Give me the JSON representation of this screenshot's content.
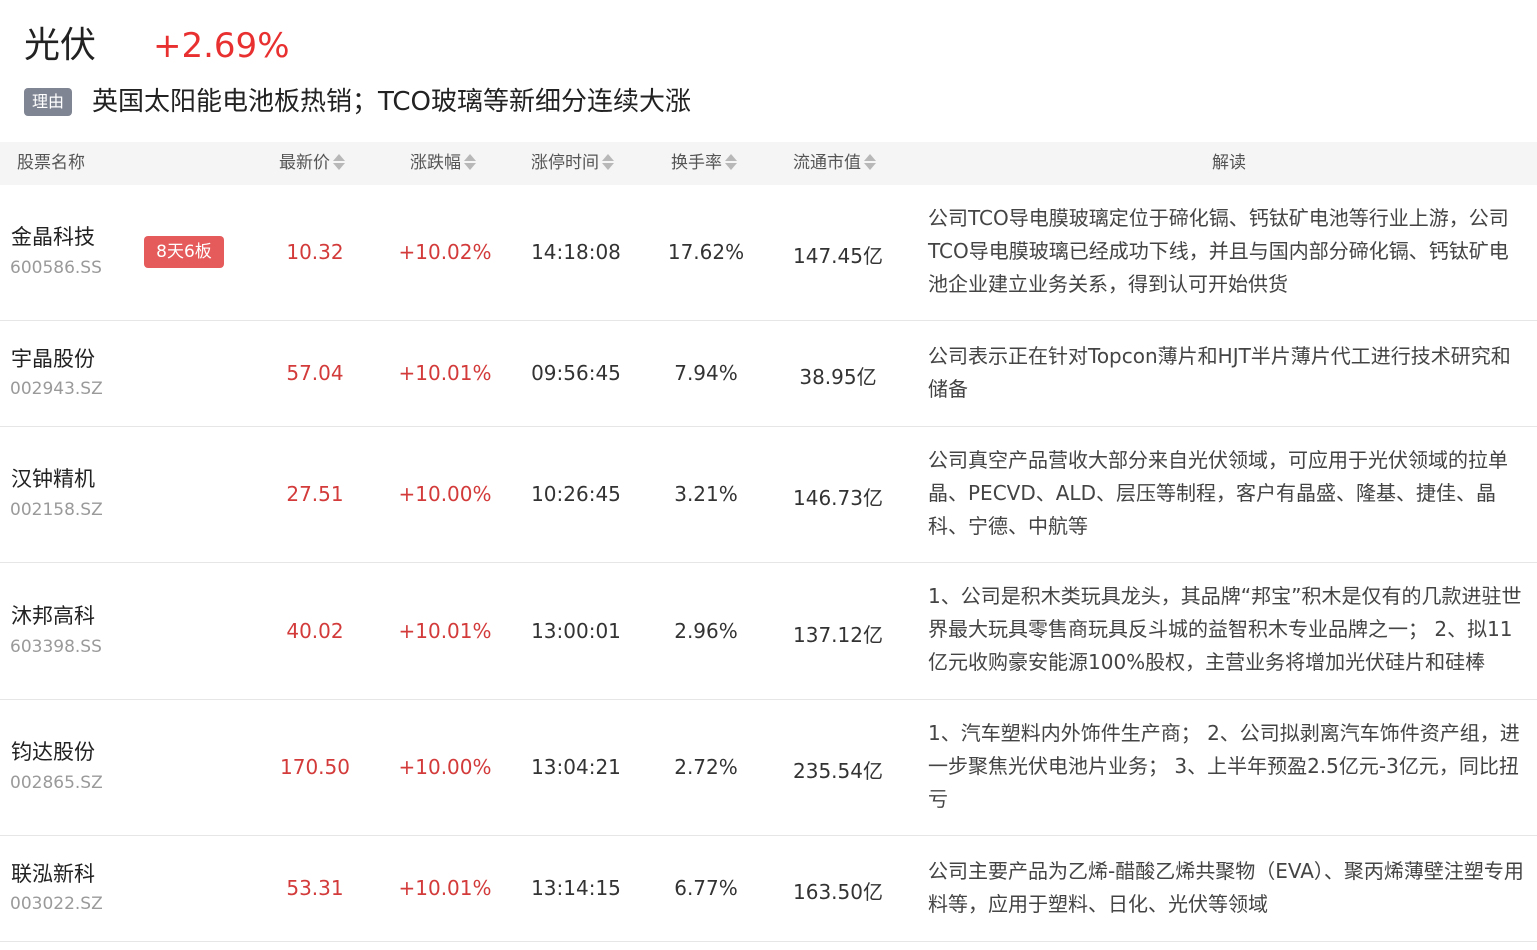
{
  "sector": {
    "name": "光伏",
    "change": "+2.69%"
  },
  "reason": {
    "tag": "理由",
    "text": "英国太阳能电池板热销；TCO玻璃等新细分连续大涨"
  },
  "columns": {
    "name": "股票名称",
    "price": "最新价",
    "change": "涨跌幅",
    "limit_time": "涨停时间",
    "turnover": "换手率",
    "market_cap": "流通市值",
    "description": "解读"
  },
  "rows": [
    {
      "name": "金晶科技",
      "code": "600586.SS",
      "tag": "8天6板",
      "price": "10.32",
      "change": "+10.02%",
      "time": "14:18:08",
      "turnover": "17.62%",
      "market_cap": "147.45亿",
      "desc": "公司TCO导电膜玻璃定位于碲化镉、钙钛矿电池等行业上游，公司TCO导电膜玻璃已经成功下线，并且与国内部分碲化镉、钙钛矿电池企业建立业务关系，得到认可开始供货"
    },
    {
      "name": "宇晶股份",
      "code": "002943.SZ",
      "price": "57.04",
      "change": "+10.01%",
      "time": "09:56:45",
      "turnover": "7.94%",
      "market_cap": "38.95亿",
      "desc": "公司表示正在针对Topcon薄片和HJT半片薄片代工进行技术研究和储备"
    },
    {
      "name": "汉钟精机",
      "code": "002158.SZ",
      "price": "27.51",
      "change": "+10.00%",
      "time": "10:26:45",
      "turnover": "3.21%",
      "market_cap": "146.73亿",
      "desc": "公司真空产品营收大部分来自光伏领域，可应用于光伏领域的拉单晶、PECVD、ALD、层压等制程，客户有晶盛、隆基、捷佳、晶科、宁德、中航等"
    },
    {
      "name": "沐邦高科",
      "code": "603398.SS",
      "price": "40.02",
      "change": "+10.01%",
      "time": "13:00:01",
      "turnover": "2.96%",
      "market_cap": "137.12亿",
      "desc": "1、公司是积木类玩具龙头，其品牌“邦宝”积木是仅有的几款进驻世界最大玩具零售商玩具反斗城的益智积木专业品牌之一； 2、拟11亿元收购豪安能源100%股权，主营业务将增加光伏硅片和硅棒"
    },
    {
      "name": "钧达股份",
      "code": "002865.SZ",
      "price": "170.50",
      "change": "+10.00%",
      "time": "13:04:21",
      "turnover": "2.72%",
      "market_cap": "235.54亿",
      "desc": "1、汽车塑料内外饰件生产商； 2、公司拟剥离汽车饰件资产组，进一步聚焦光伏电池片业务； 3、上半年预盈2.5亿元-3亿元，同比扭亏"
    },
    {
      "name": "联泓新科",
      "code": "003022.SZ",
      "price": "53.31",
      "change": "+10.01%",
      "time": "13:14:15",
      "turnover": "6.77%",
      "market_cap": "163.50亿",
      "desc": "公司主要产品为乙烯-醋酸乙烯共聚物（EVA）、聚丙烯薄壁注塑专用料等，应用于塑料、日化、光伏等领域"
    }
  ],
  "colors": {
    "up": "#d33b3b",
    "tag_bg": "#e55b5b",
    "reason_tag_bg": "#7f8592",
    "header_bg": "#f5f5f5"
  },
  "icons": {
    "sort": "sort-updown-icon"
  }
}
